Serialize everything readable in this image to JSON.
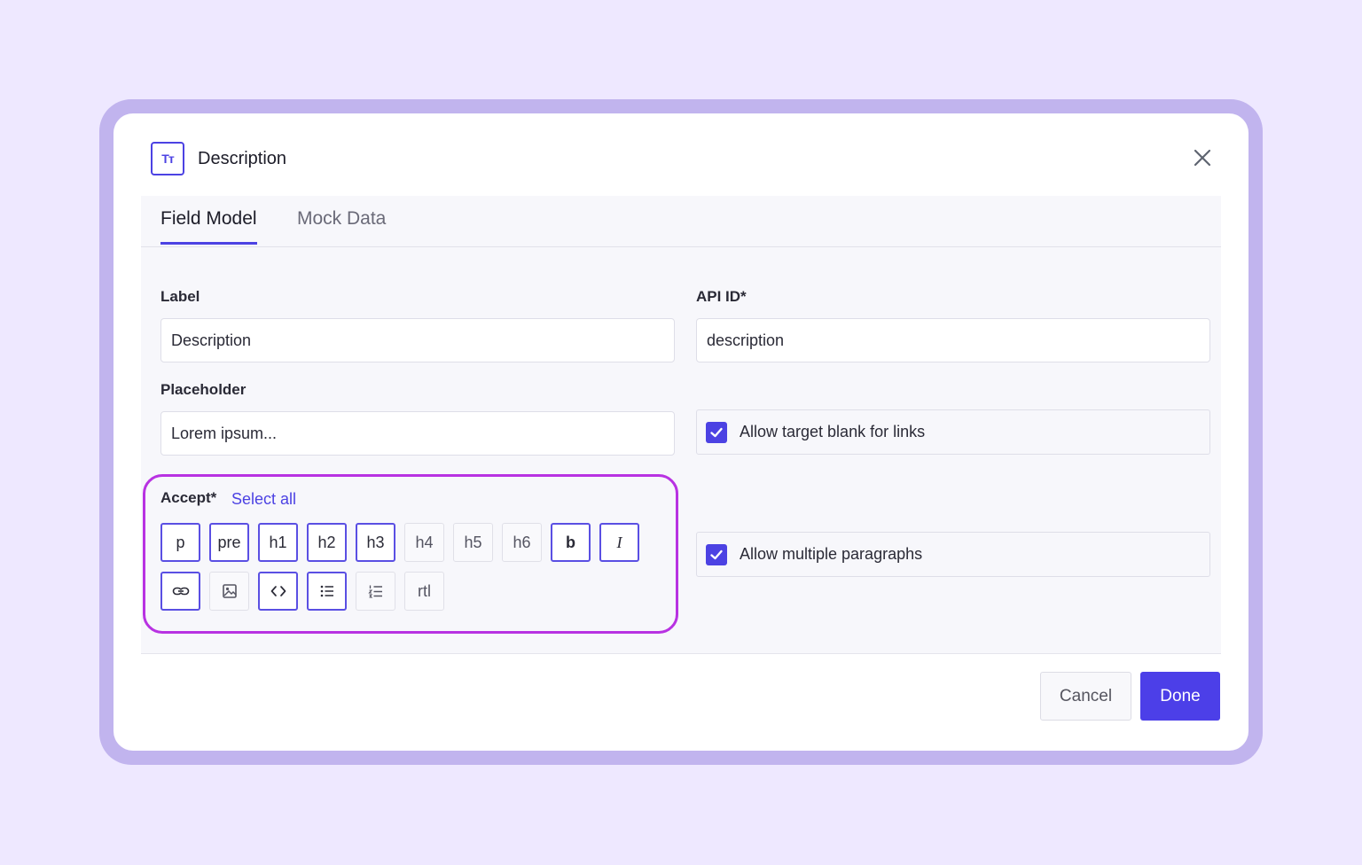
{
  "dialog": {
    "title": "Description",
    "type_icon_glyph": "Tт",
    "type_icon": "text-type-icon",
    "close_icon": "close-icon"
  },
  "tabs": [
    {
      "label": "Field Model",
      "active": true
    },
    {
      "label": "Mock Data",
      "active": false
    }
  ],
  "form": {
    "label": {
      "label": "Label",
      "value": "Description"
    },
    "api_id": {
      "label": "API ID*",
      "value": "description"
    },
    "placeholder": {
      "label": "Placeholder",
      "value": "Lorem ipsum..."
    },
    "allow_target_blank": {
      "label": "Allow target blank for links",
      "checked": true
    },
    "allow_multiple_paragraphs": {
      "label": "Allow multiple paragraphs",
      "checked": true
    }
  },
  "accept": {
    "label": "Accept*",
    "select_all": "Select all",
    "row1": [
      {
        "text": "p",
        "selected": true
      },
      {
        "text": "pre",
        "selected": true
      },
      {
        "text": "h1",
        "selected": true
      },
      {
        "text": "h2",
        "selected": true
      },
      {
        "text": "h3",
        "selected": true
      },
      {
        "text": "h4",
        "selected": false
      },
      {
        "text": "h5",
        "selected": false
      },
      {
        "text": "h6",
        "selected": false
      },
      {
        "text": "b",
        "selected": true
      },
      {
        "text": "I",
        "selected": true
      }
    ],
    "row2": [
      {
        "icon": "link-icon",
        "selected": true
      },
      {
        "icon": "image-icon",
        "selected": false
      },
      {
        "icon": "code-icon",
        "selected": true
      },
      {
        "icon": "bulleted-list-icon",
        "selected": true
      },
      {
        "icon": "numbered-list-icon",
        "selected": false
      },
      {
        "text": "rtl",
        "selected": false
      }
    ]
  },
  "footer": {
    "cancel_label": "Cancel",
    "done_label": "Done"
  },
  "colors": {
    "accent": "#4c42e3",
    "highlight": "#b832e2",
    "frame": "#c1b4ee",
    "background": "#eee8ff"
  }
}
